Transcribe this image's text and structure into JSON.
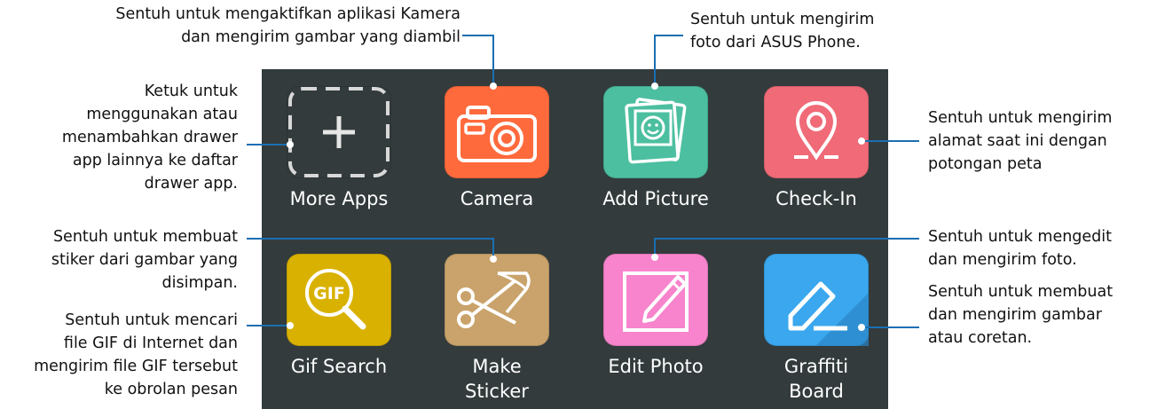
{
  "apps": [
    {
      "label": "More Apps",
      "icon": "plus-icon",
      "color": "#333b3c"
    },
    {
      "label": "Camera",
      "icon": "camera-icon",
      "color": "#ff6a3d"
    },
    {
      "label": "Add Picture",
      "icon": "pictures-icon",
      "color": "#4cbfa0"
    },
    {
      "label": "Check-In",
      "icon": "location-pin-icon",
      "color": "#f06a78"
    },
    {
      "label": "Gif Search",
      "icon": "gif-search-icon",
      "color": "#d9b100"
    },
    {
      "label": [
        "Make",
        "Sticker"
      ],
      "icon": "scissors-icon",
      "color": "#c9a36b"
    },
    {
      "label": "Edit Photo",
      "icon": "pencil-icon",
      "color": "#f784cc"
    },
    {
      "label": [
        "Graffiti",
        "Board"
      ],
      "icon": "marker-icon",
      "color": "#3aa7ee"
    }
  ],
  "annotations": {
    "camera": [
      "Sentuh untuk mengaktifkan aplikasi Kamera",
      "dan mengirim gambar yang diambil"
    ],
    "add_picture": [
      "Sentuh untuk mengirim",
      "foto dari ASUS Phone."
    ],
    "more_apps": [
      "Ketuk untuk",
      "menggunakan atau",
      "menambahkan drawer",
      "app lainnya ke daftar",
      "drawer app."
    ],
    "check_in": [
      "Sentuh untuk mengirim",
      "alamat saat ini dengan",
      "potongan peta"
    ],
    "make_sticker": [
      "Sentuh untuk membuat",
      "stiker dari gambar yang",
      "disimpan."
    ],
    "gif_search": [
      "Sentuh untuk mencari",
      "file GIF di Internet dan",
      "mengirim file GIF tersebut",
      "ke obrolan pesan"
    ],
    "edit_photo": [
      "Sentuh untuk mengedit",
      "dan mengirim foto."
    ],
    "graffiti_board": [
      "Sentuh untuk membuat",
      "dan mengirim gambar",
      "atau coretan."
    ]
  },
  "colors": {
    "panel": "#333b3c",
    "leader_line": "#1a6fb3"
  }
}
